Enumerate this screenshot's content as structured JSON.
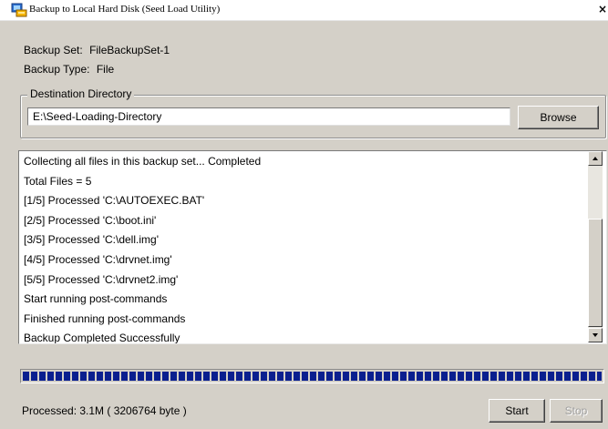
{
  "window": {
    "title": "Backup to Local Hard Disk (Seed Load Utility)",
    "close_symbol": "×"
  },
  "info": {
    "backup_set_label": "Backup Set:",
    "backup_set_value": "FileBackupSet-1",
    "backup_type_label": "Backup Type:",
    "backup_type_value": "File"
  },
  "destination": {
    "group_label": "Destination Directory",
    "path": "E:\\Seed-Loading-Directory",
    "browse_label": "Browse"
  },
  "log": {
    "lines": [
      "Collecting all files in this backup set... Completed",
      "Total Files = 5",
      "[1/5] Processed 'C:\\AUTOEXEC.BAT'",
      "[2/5] Processed 'C:\\boot.ini'",
      "[3/5] Processed 'C:\\dell.img'",
      "[4/5] Processed 'C:\\drvnet.img'",
      "[5/5] Processed 'C:\\drvnet2.img'",
      "Start running post-commands",
      "Finished running post-commands",
      "Backup Completed Successfully"
    ]
  },
  "progress": {
    "fraction": 1.0,
    "color": "#0a1f8f"
  },
  "status": {
    "processed_text": "Processed: 3.1M ( 3206764 byte )"
  },
  "buttons": {
    "start_label": "Start",
    "stop_label": "Stop"
  },
  "icons": {
    "app": "backup-app-icon",
    "close": "close-icon",
    "scroll_up": "scroll-up-arrow-icon",
    "scroll_down": "scroll-down-arrow-icon"
  }
}
